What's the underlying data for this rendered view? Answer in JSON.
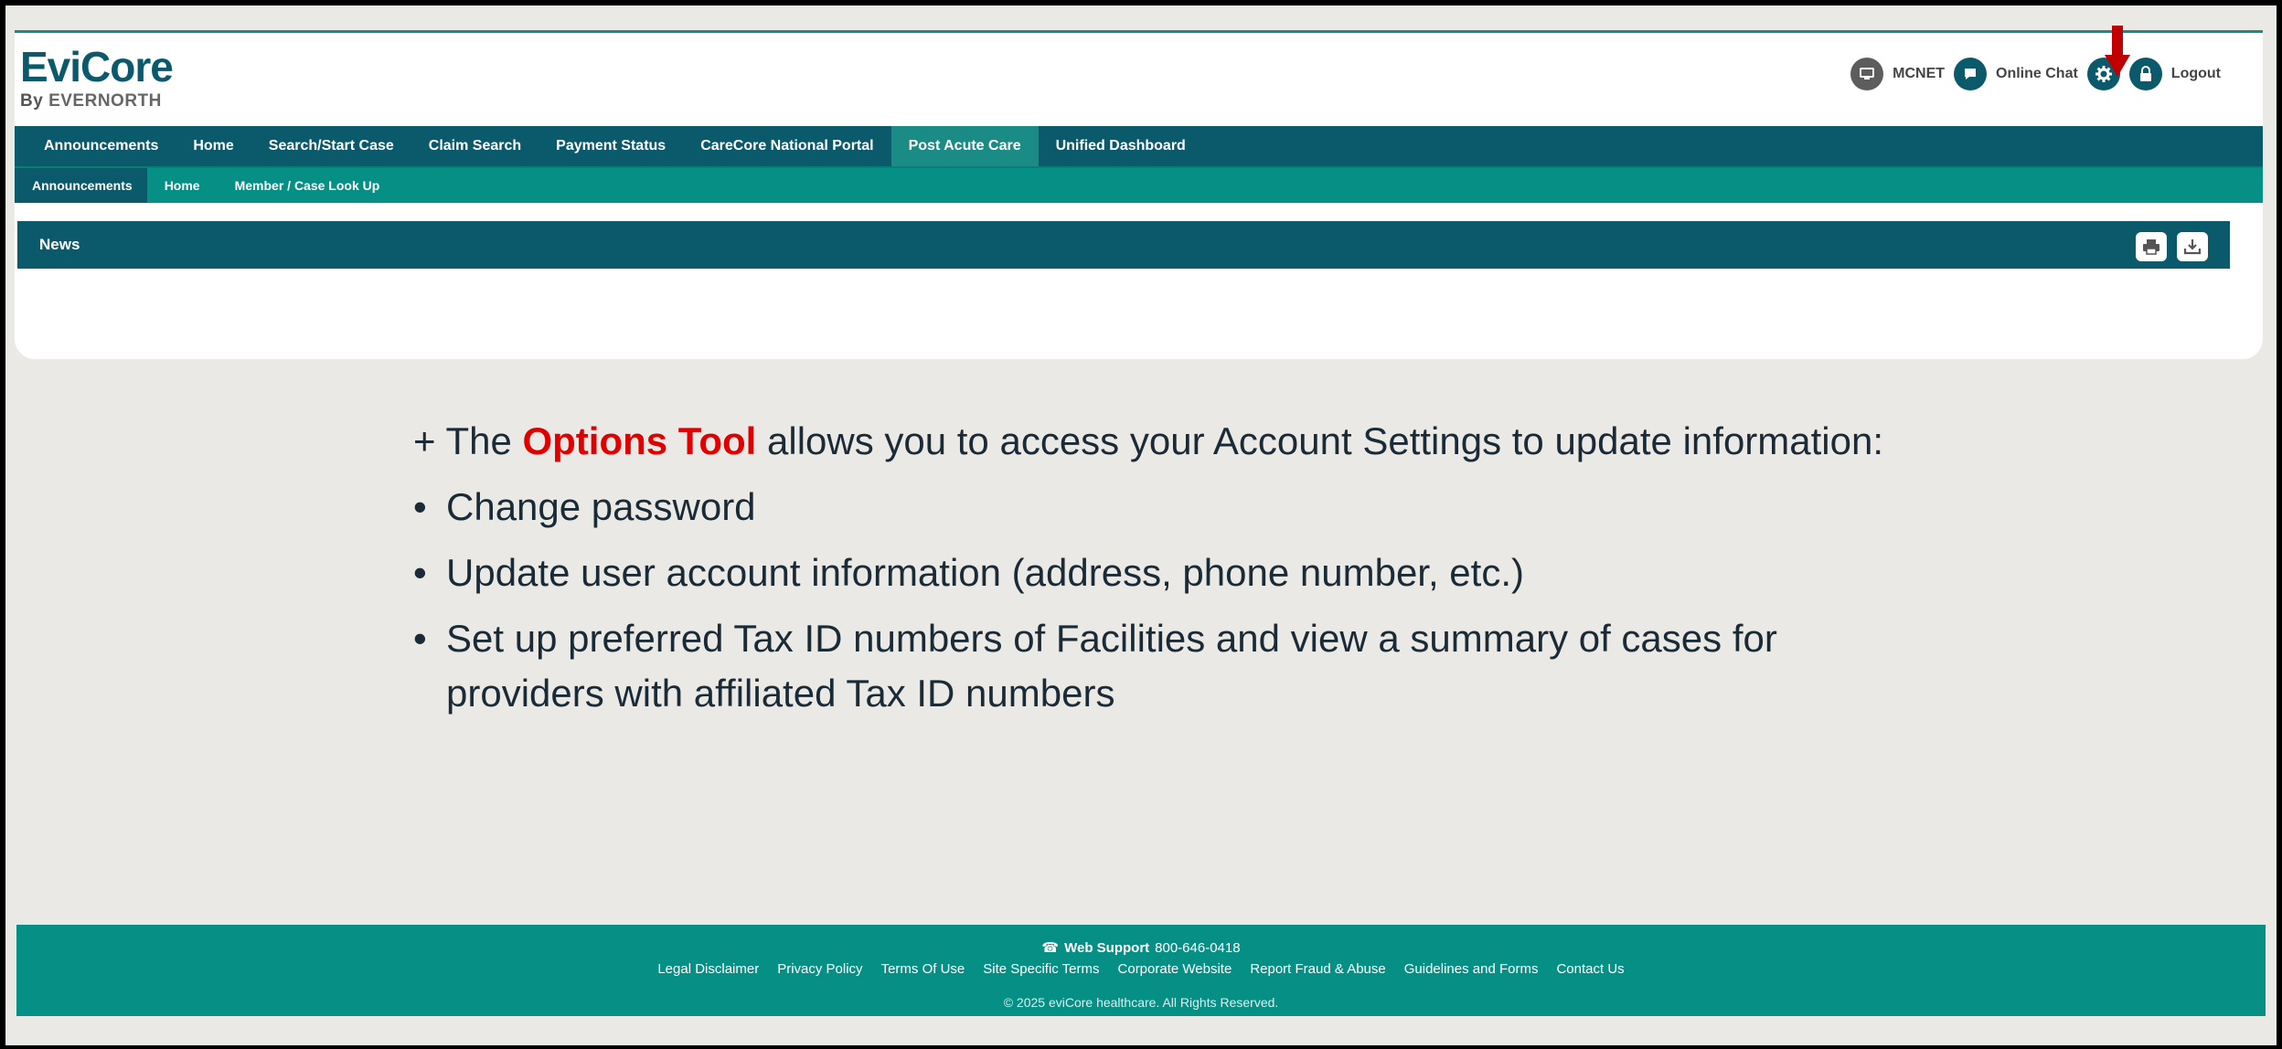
{
  "header": {
    "logo_main": "EviCore",
    "logo_by": "By",
    "logo_brand": "EVERNORTH"
  },
  "utilities": {
    "mcnet": "MCNET",
    "online_chat": "Online Chat",
    "logout": "Logout"
  },
  "icons": {
    "mcnet": "monitor-icon",
    "chat": "chat-bubble-icon",
    "settings": "gear-icon",
    "logout": "lock-icon",
    "print": "printer-icon",
    "download": "download-icon",
    "annotation": "red-arrow-icon"
  },
  "nav_primary": [
    {
      "label": "Announcements"
    },
    {
      "label": "Home"
    },
    {
      "label": "Search/Start Case"
    },
    {
      "label": "Claim Search"
    },
    {
      "label": "Payment Status"
    },
    {
      "label": "CareCore National Portal"
    },
    {
      "label": "Post Acute Care",
      "active": true
    },
    {
      "label": "Unified Dashboard"
    }
  ],
  "nav_secondary": [
    {
      "label": "Announcements",
      "active": true
    },
    {
      "label": "Home"
    },
    {
      "label": "Member / Case Look Up"
    }
  ],
  "news": {
    "title": "News"
  },
  "slide": {
    "intro_prefix": "+ The",
    "intro_highlight": "Options Tool",
    "intro_suffix": "allows you to access your Account Settings to update information:",
    "bullets": [
      "Change password",
      "Update user account information (address, phone number, etc.)",
      "Set up preferred Tax ID numbers of Facilities and view a summary of cases for",
      "providers with affiliated Tax ID numbers"
    ],
    "bullet_symbol": "•"
  },
  "footer": {
    "web_support_label": "Web Support",
    "web_support_phone": "800-646-0418",
    "links": [
      "Legal Disclaimer",
      "Privacy Policy",
      "Terms Of Use",
      "Site Specific Terms",
      "Corporate Website",
      "Report Fraud & Abuse",
      "Guidelines and Forms",
      "Contact Us"
    ],
    "copyright": "© 2025 eviCore healthcare. All Rights Reserved."
  },
  "colors": {
    "primary": "#0b5a6b",
    "secondary": "#058f85",
    "highlight": "#e00000"
  }
}
